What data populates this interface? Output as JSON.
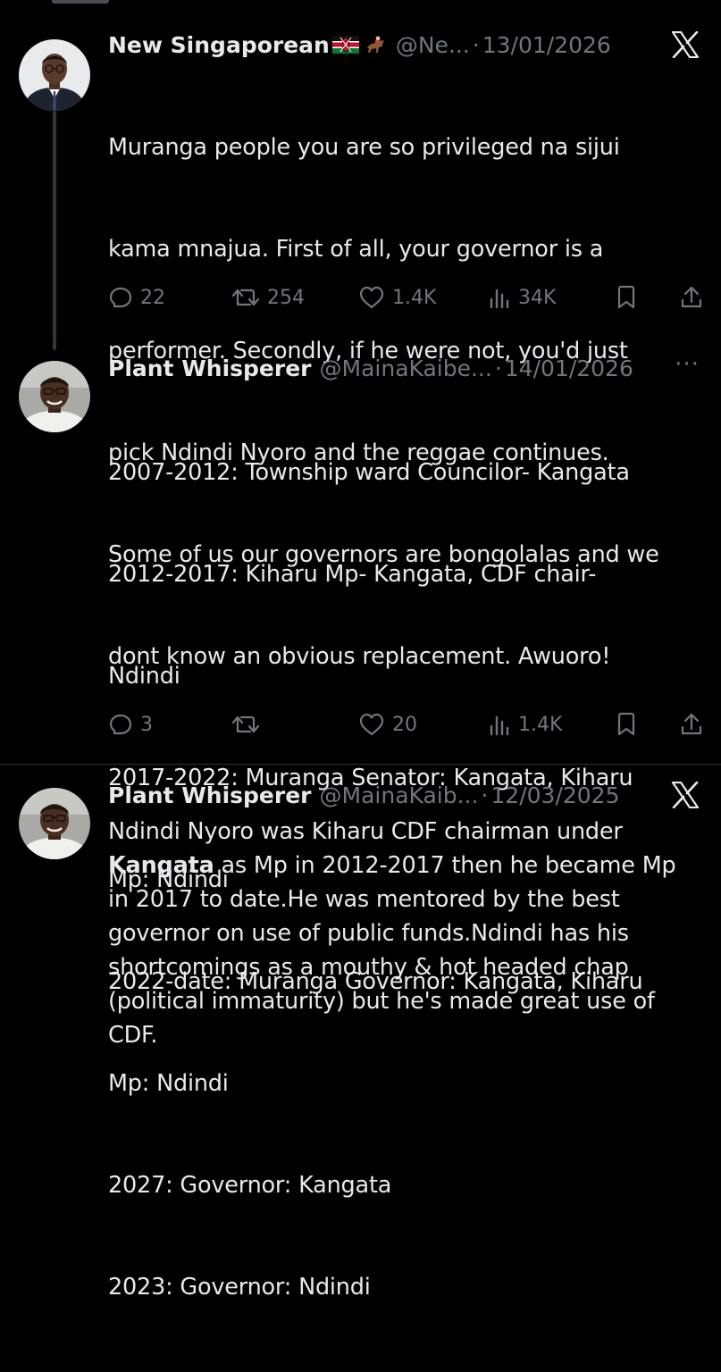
{
  "tweets": [
    {
      "author_name": "New Singaporean",
      "badges": [
        "kenya-flag-emoji",
        "horse-racing-emoji"
      ],
      "handle": "@Ne...",
      "separator": "·",
      "date": "13/01/2026",
      "header_icon": "x-logo-icon",
      "text_lines": [
        "Muranga people you are so privileged na sijui",
        "kama mnajua. First of all, your governor is a",
        "performer. Secondly, if he were not, you'd just",
        "pick Ndindi Nyoro and the reggae continues.",
        "Some of us our governors are bongolalas and we",
        "dont know an obvious replacement. Awuoro!"
      ],
      "stats": {
        "replies": "22",
        "reposts": "254",
        "likes": "1.4K",
        "views": "34K"
      }
    },
    {
      "author_name": "Plant Whisperer",
      "handle": "@MainaKaibe...",
      "separator": "·",
      "date": "14/01/2026",
      "header_icon": "more-icon",
      "more_label": "···",
      "text_lines": [
        "2007-2012: Township ward Councilor- Kangata",
        "2012-2017: Kiharu Mp- Kangata, CDF chair-",
        "Ndindi",
        "2017-2022: Muranga Senator: Kangata, Kiharu",
        "Mp: Ndindi",
        "2022-date: Muranga Governor: Kangata, Kiharu",
        "Mp: Ndindi",
        "2027: Governor: Kangata",
        "2023: Governor: Ndindi"
      ],
      "stats": {
        "replies": "3",
        "reposts": "",
        "likes": "20",
        "views": "1.4K"
      }
    },
    {
      "author_name": "Plant Whisperer",
      "handle": "@MainaKaib...",
      "separator": "·",
      "date": "12/03/2025",
      "header_icon": "x-logo-icon",
      "text_segments": [
        {
          "text": "Ndindi Nyoro was Kiharu CDF chairman under\n",
          "bold": false
        },
        {
          "text": "Kangata",
          "bold": true
        },
        {
          "text": " as Mp in 2012-2017 then he became Mp\nin 2017 to date.He was mentored by the best\ngovernor on use of public funds.Ndindi has his\nshortcomings as a mouthy & hot headed chap\n(political immaturity) but he's made great use of\nCDF.",
          "bold": false
        }
      ]
    }
  ],
  "colors": {
    "background": "#000000",
    "text": "#e7e9ea",
    "secondary": "#71767b",
    "divider": "#2f3336",
    "thread_line": "#333639"
  }
}
